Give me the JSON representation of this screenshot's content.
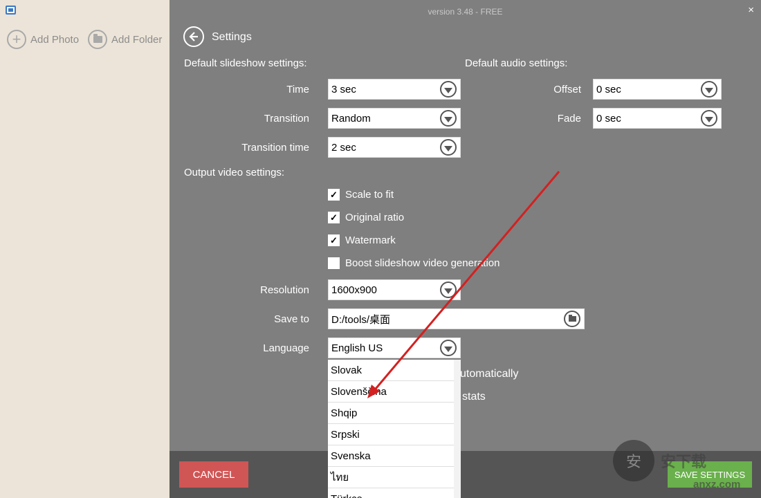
{
  "sidebar": {
    "add_photo": "Add Photo",
    "add_folder": "Add Folder"
  },
  "header": {
    "version": "version 3.48 - FREE",
    "close": "×",
    "title": "Settings"
  },
  "slideshow": {
    "section_title": "Default slideshow settings:",
    "time_label": "Time",
    "time_value": "3 sec",
    "transition_label": "Transition",
    "transition_value": "Random",
    "transition_time_label": "Transition time",
    "transition_time_value": "2 sec"
  },
  "audio": {
    "section_title": "Default audio settings:",
    "offset_label": "Offset",
    "offset_value": "0 sec",
    "fade_label": "Fade",
    "fade_value": "0 sec"
  },
  "output": {
    "section_title": "Output video settings:",
    "scale_to_fit": "Scale to fit",
    "original_ratio": "Original ratio",
    "watermark": "Watermark",
    "boost": "Boost slideshow video generation",
    "resolution_label": "Resolution",
    "resolution_value": "1600x900",
    "save_to_label": "Save to",
    "save_to_value": "D:/tools/桌面",
    "language_label": "Language",
    "language_value": "English US",
    "hidden_text_1": "utomatically",
    "hidden_text_2": "stats"
  },
  "language_options": [
    "Slovak",
    "Slovenščina",
    "Shqip",
    "Srpski",
    "Svenska",
    "ไทย",
    "Türkçe"
  ],
  "buttons": {
    "cancel": "CANCEL",
    "save": "SAVE SETTINGS"
  },
  "watermark_overlay": {
    "shield": "安",
    "brand": "安下载",
    "url": "anxz.com"
  },
  "colors": {
    "main_bg": "#7f7f7f",
    "sidebar_bg": "#ece4d8",
    "cancel": "#d05555",
    "save": "#6ab04c",
    "arrow": "#d42020"
  }
}
